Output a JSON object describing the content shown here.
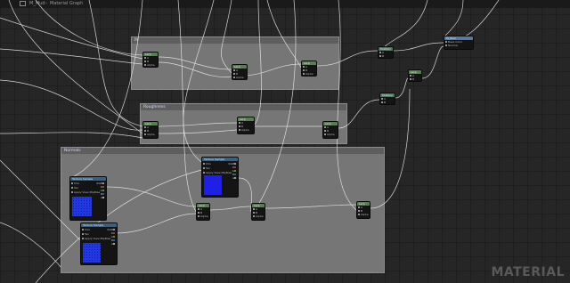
{
  "breadcrumb": {
    "asset": "M_Mud",
    "separator": "›",
    "page": "Material Graph"
  },
  "comments": [
    {
      "title": "M"
    },
    {
      "title": "Roughness"
    },
    {
      "title": "Normals"
    }
  ],
  "nodes": {
    "lerp_m1": {
      "title": "Lerp",
      "pins": [
        "A",
        "B",
        "Alpha"
      ]
    },
    "lerp_m2": {
      "title": "Lerp",
      "pins": [
        "A",
        "B",
        "Alpha"
      ]
    },
    "lerp_m3": {
      "title": "Lerp",
      "pins": [
        "A",
        "B",
        "Alpha"
      ]
    },
    "lerp_r1": {
      "title": "Lerp",
      "pins": [
        "A",
        "B",
        "Alpha"
      ]
    },
    "lerp_r2": {
      "title": "Lerp",
      "pins": [
        "A",
        "B",
        "Alpha"
      ]
    },
    "lerp_r3": {
      "title": "Lerp",
      "pins": [
        "A",
        "B",
        "Alpha"
      ]
    },
    "tex1": {
      "title": "Texture Sample",
      "pins": [
        "UVs",
        "Tex",
        "Apply View MipBias"
      ],
      "outs": [
        "RGB",
        "R",
        "G",
        "B",
        "A"
      ]
    },
    "tex2": {
      "title": "Texture Sample",
      "pins": [
        "UVs",
        "Tex",
        "Apply View MipBias"
      ],
      "outs": [
        "RGB",
        "R",
        "G",
        "B",
        "A"
      ]
    },
    "tex3": {
      "title": "Texture Sample",
      "pins": [
        "UVs",
        "Tex",
        "Apply View MipBias"
      ],
      "outs": [
        "RGB",
        "R",
        "G",
        "B",
        "A"
      ]
    },
    "lerp_n1": {
      "title": "Lerp",
      "pins": [
        "A",
        "B",
        "Alpha"
      ]
    },
    "lerp_n2": {
      "title": "Lerp",
      "pins": [
        "A",
        "B",
        "Alpha"
      ]
    },
    "lerp_n3": {
      "title": "Lerp",
      "pins": [
        "A",
        "B",
        "Alpha"
      ]
    },
    "mult_top": {
      "title": "Multiply",
      "pins": [
        "A",
        "B"
      ]
    },
    "mult_mid": {
      "title": "Multiply",
      "pins": [
        "A",
        "B"
      ]
    },
    "lerp_mid": {
      "title": "Lerp",
      "pins": [
        "A",
        "B"
      ]
    },
    "output": {
      "title": "M_Mud",
      "pins": [
        "Base Color",
        "Normal"
      ]
    }
  },
  "watermark": "MATERIAL"
}
